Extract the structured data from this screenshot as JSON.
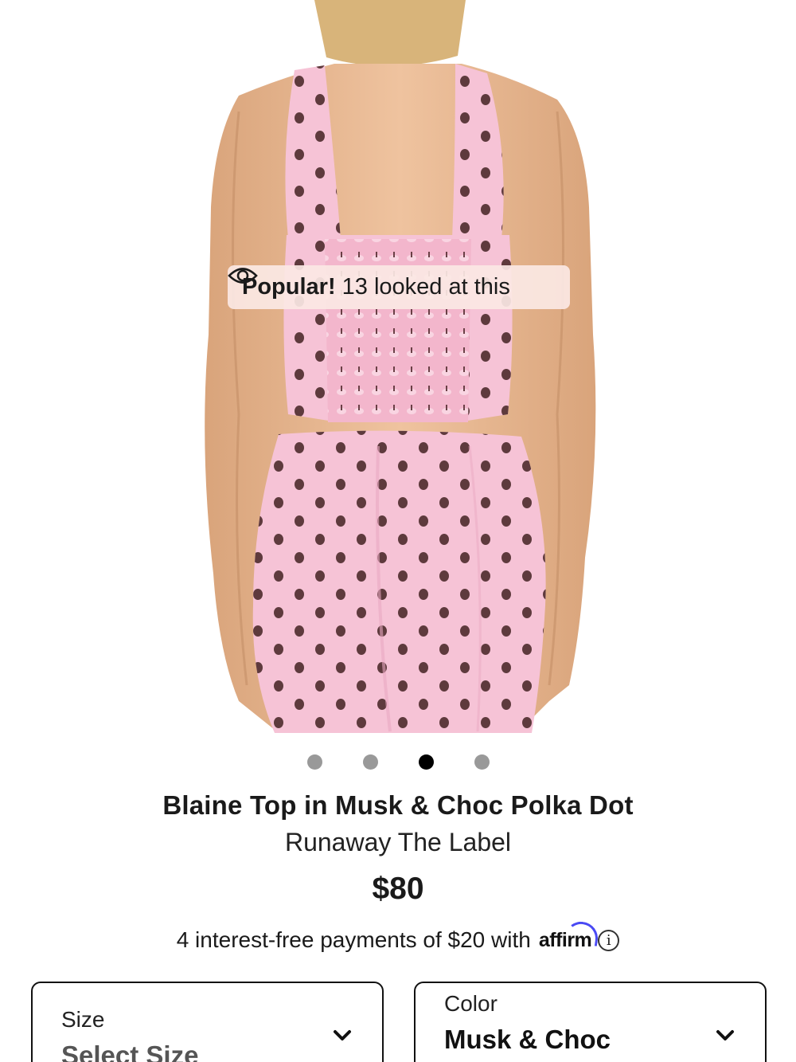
{
  "badge": {
    "icon": "eye-icon",
    "strong": "Popular!",
    "text": "13 looked at this"
  },
  "carousel": {
    "count": 4,
    "active_index": 2
  },
  "product": {
    "title": "Blaine Top in Musk & Choc Polka Dot",
    "brand": "Runaway The Label",
    "price": "$80"
  },
  "affirm": {
    "text": "4 interest-free payments of $20 with",
    "logo": "affirm",
    "info_glyph": "i"
  },
  "size_selector": {
    "label": "Size",
    "value": "Select Size",
    "icon": "chevron-down-icon"
  },
  "color_selector": {
    "label": "Color",
    "value": "Musk & Choc",
    "icon": "chevron-down-icon"
  },
  "colors": {
    "garment_pink": "#f6c3d6",
    "polka_dot": "#5e3a3d",
    "skin": "#e8b890",
    "hair": "#d8b47a",
    "active_dot": "#000000",
    "inactive_dot": "#999999",
    "affirm_blue": "#4a4af4"
  }
}
